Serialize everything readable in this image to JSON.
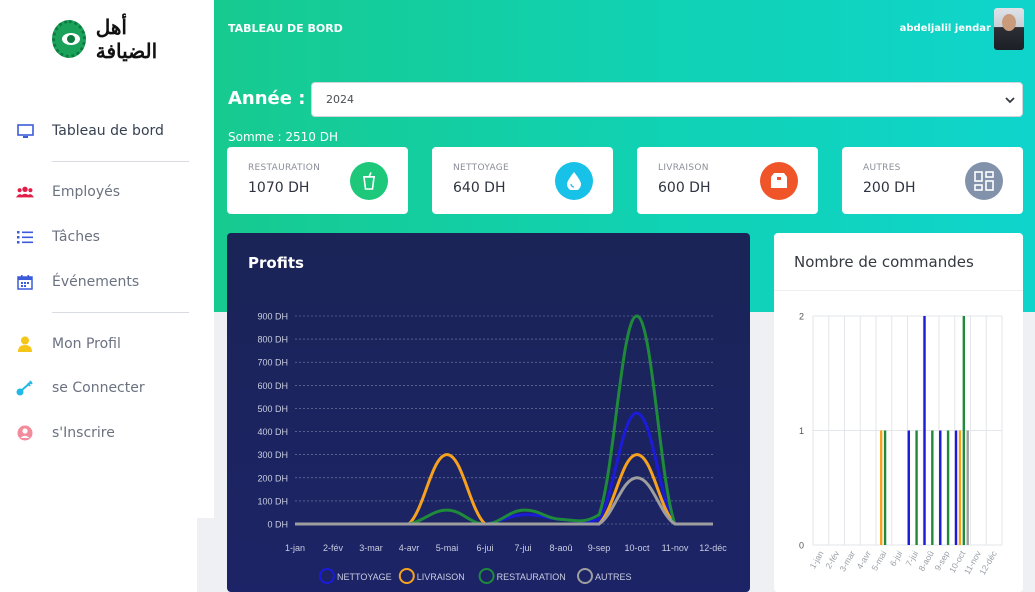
{
  "app": {
    "logo_text": "أهل الضيافة",
    "page_title": "TABLEAU DE BORD",
    "username": "abdeljalil jendar"
  },
  "sidebar": {
    "items": [
      {
        "label": "Tableau de bord",
        "icon": "monitor-icon",
        "color": "#3b5bdb"
      },
      {
        "label": "Employés",
        "icon": "users-icon",
        "color": "#e11d48"
      },
      {
        "label": "Tâches",
        "icon": "list-icon",
        "color": "#3b5bdb"
      },
      {
        "label": "Événements",
        "icon": "calendar-icon",
        "color": "#3b5bdb"
      },
      {
        "label": "Mon Profil",
        "icon": "user-icon",
        "color": "#f5c518"
      },
      {
        "label": "se Connecter",
        "icon": "key-icon",
        "color": "#22b8e6"
      },
      {
        "label": "s'Inscrire",
        "icon": "user-circle-icon",
        "color": "#f28b9b"
      }
    ]
  },
  "filter": {
    "year_label": "Année :",
    "year_value": "2024",
    "sum_label": "Somme : 2510 DH"
  },
  "cards": [
    {
      "title": "RESTAURATION",
      "value": "1070 DH",
      "icon": "cup-icon",
      "color": "#1ec87a"
    },
    {
      "title": "NETTOYAGE",
      "value": "640 DH",
      "icon": "drop-icon",
      "color": "#17c1e8"
    },
    {
      "title": "LIVRAISON",
      "value": "600 DH",
      "icon": "box-icon",
      "color": "#f0552a"
    },
    {
      "title": "AUTRES",
      "value": "200 DH",
      "icon": "grid-icon",
      "color": "#8392ab"
    }
  ],
  "profits": {
    "title": "Profits"
  },
  "orders": {
    "title": "Nombre de commandes"
  },
  "chart_data": [
    {
      "type": "line",
      "title": "Profits",
      "categories": [
        "1-jan",
        "2-fév",
        "3-mar",
        "4-avr",
        "5-mai",
        "6-jui",
        "7-jui",
        "8-aoû",
        "9-sep",
        "10-oct",
        "11-nov",
        "12-déc"
      ],
      "yticks": [
        "0 DH",
        "100 DH",
        "200 DH",
        "300 DH",
        "400 DH",
        "500 DH",
        "600 DH",
        "700 DH",
        "800 DH",
        "900 DH"
      ],
      "ylim": [
        0,
        900
      ],
      "grid": true,
      "legend": "bottom",
      "series": [
        {
          "name": "NETTOYAGE",
          "color": "#1b1bd9",
          "values": [
            0,
            0,
            0,
            0,
            0,
            0,
            40,
            20,
            20,
            480,
            0,
            0
          ]
        },
        {
          "name": "LIVRAISON",
          "color": "#f6a21e",
          "values": [
            0,
            0,
            0,
            0,
            300,
            0,
            0,
            0,
            0,
            300,
            0,
            0
          ]
        },
        {
          "name": "RESTAURATION",
          "color": "#1e8a3a",
          "values": [
            0,
            0,
            0,
            0,
            60,
            0,
            60,
            20,
            40,
            900,
            0,
            0
          ]
        },
        {
          "name": "AUTRES",
          "color": "#9e9e9e",
          "values": [
            0,
            0,
            0,
            0,
            0,
            0,
            0,
            0,
            0,
            200,
            0,
            0
          ]
        }
      ]
    },
    {
      "type": "bar",
      "title": "Nombre de commandes",
      "categories": [
        "1-jan",
        "2-fév",
        "3-mar",
        "4-avr",
        "5-mai",
        "6-jui",
        "7-jui",
        "8-aoû",
        "9-sep",
        "10-oct",
        "11-nov",
        "12-déc"
      ],
      "yticks": [
        "0",
        "1",
        "2"
      ],
      "ylim": [
        0,
        2
      ],
      "grid": true,
      "series": [
        {
          "name": "NETTOYAGE",
          "color": "#1b1bd9",
          "values": [
            0,
            0,
            0,
            0,
            0,
            0,
            1,
            2,
            1,
            1,
            0,
            0
          ]
        },
        {
          "name": "LIVRAISON",
          "color": "#f6a21e",
          "values": [
            0,
            0,
            0,
            0,
            1,
            0,
            0,
            0,
            0,
            1,
            0,
            0
          ]
        },
        {
          "name": "RESTAURATION",
          "color": "#1e8a3a",
          "values": [
            0,
            0,
            0,
            0,
            1,
            0,
            1,
            1,
            1,
            2,
            0,
            0
          ]
        },
        {
          "name": "AUTRES",
          "color": "#9e9e9e",
          "values": [
            0,
            0,
            0,
            0,
            0,
            0,
            0,
            0,
            0,
            1,
            0,
            0
          ]
        }
      ]
    }
  ]
}
